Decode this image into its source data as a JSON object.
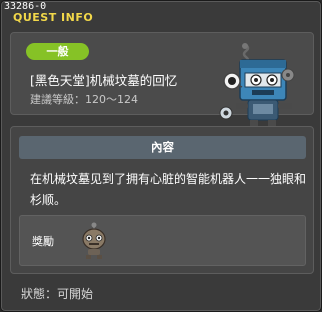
{
  "window": {
    "quest_id": "33286-0",
    "title": "QUEST INFO"
  },
  "header": {
    "category": "一般",
    "quest_name": "[黑色天堂]机械坟墓的回忆",
    "level_requirement": "建議等級：120～124"
  },
  "content": {
    "heading": "內容",
    "description": "在机械坟墓见到了拥有心脏的智能机器人一一独眼和杉顺。",
    "reward_label": "獎勵"
  },
  "footer": {
    "status": "狀態：可開始"
  },
  "colors": {
    "title": "#f2d84a",
    "category_badge": "#86c226",
    "content_header": "#5a6670"
  },
  "icons": {
    "npc": "robot-npc-icon",
    "reward": "robot-reward-icon"
  }
}
